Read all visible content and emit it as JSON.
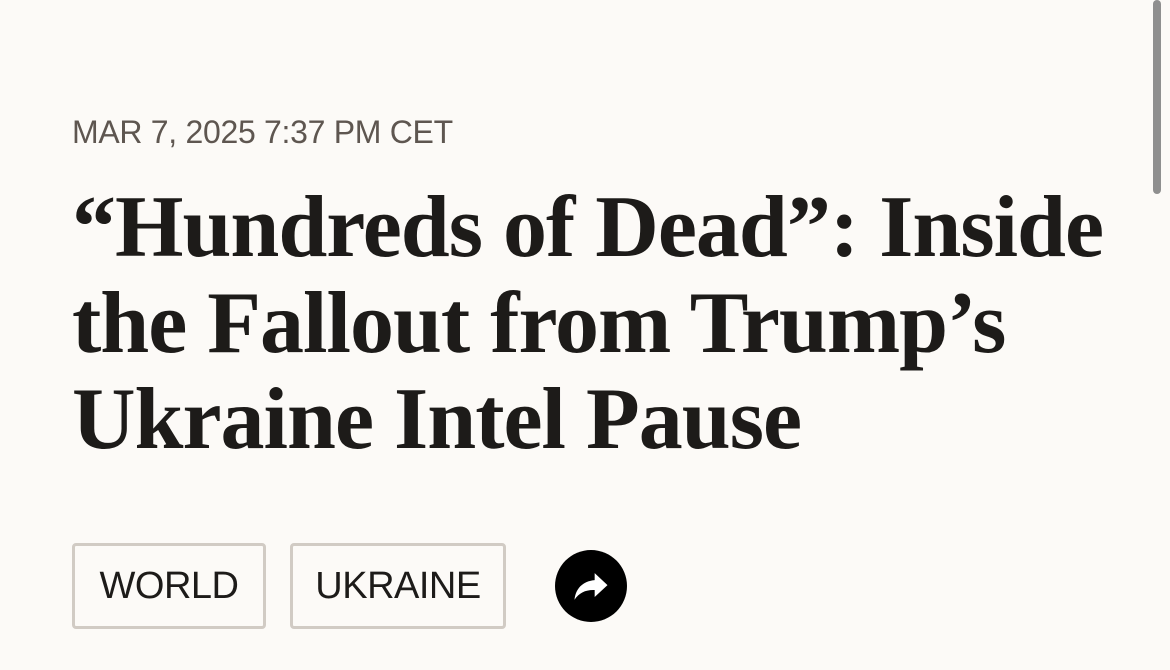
{
  "article": {
    "timestamp": "MAR 7, 2025 7:37 PM CET",
    "headline": "“Hundreds of Dead”: Inside the Fallout from Trump’s Ukraine Intel Pause",
    "tags": [
      "WORLD",
      "UKRAINE"
    ]
  },
  "share": {
    "icon": "share-arrow-icon"
  },
  "colors": {
    "background": "#fcfaf7",
    "text": "#1d1b19",
    "timestamp": "#5e5650",
    "tag_border": "#d1cbc4",
    "share_bg": "#000000"
  }
}
